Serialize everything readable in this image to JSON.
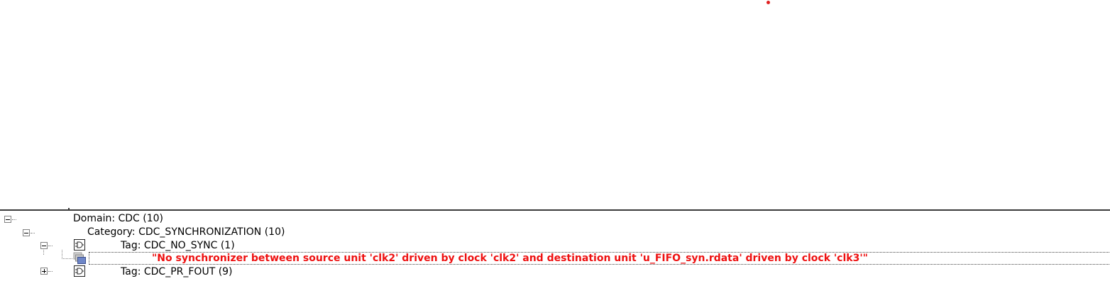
{
  "tree": {
    "domain": {
      "label": "Domain: CDC (10)"
    },
    "category": {
      "label": "Category: CDC_SYNCHRONIZATION (10)"
    },
    "tag_no_sync": {
      "label": "Tag: CDC_NO_SYNC (1)",
      "message": "\"No synchronizer between source unit 'clk2' driven by clock 'clk2' and destination unit 'u_FIFO_syn.rdata' driven by clock 'clk3'\""
    },
    "tag_pr_fout": {
      "label": "Tag: CDC_PR_FOUT (9)"
    }
  },
  "icons": {
    "expander_open": "minus-box",
    "expander_closed": "plus-box",
    "tag": "tag-gate-icon",
    "message": "message-stack-icon"
  },
  "colors": {
    "message_text": "#ee1111",
    "marker_dot": "#e02020",
    "splitter": "#3a3a3a"
  }
}
